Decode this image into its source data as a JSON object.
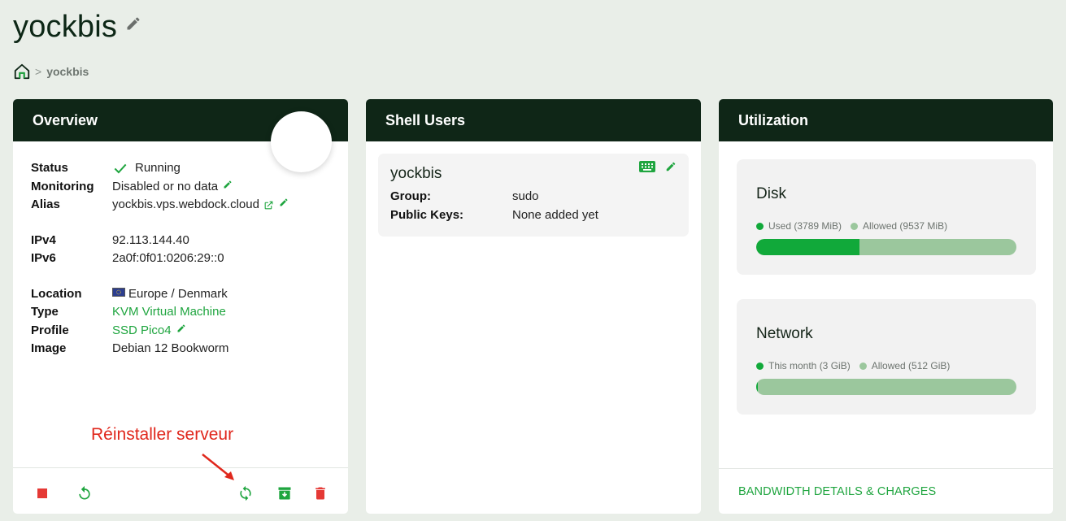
{
  "page": {
    "title": "yockbis",
    "breadcrumb": {
      "current": "yockbis",
      "separator": ">"
    }
  },
  "overview": {
    "header": "Overview",
    "rows": {
      "status": {
        "label": "Status",
        "value": "Running"
      },
      "monitoring": {
        "label": "Monitoring",
        "value": "Disabled or no data"
      },
      "alias": {
        "label": "Alias",
        "value": "yockbis.vps.webdock.cloud"
      },
      "ipv4": {
        "label": "IPv4",
        "value": "92.113.144.40"
      },
      "ipv6": {
        "label": "IPv6",
        "value": "2a0f:0f01:0206:29::0"
      },
      "location": {
        "label": "Location",
        "value": "Europe / Denmark"
      },
      "type": {
        "label": "Type",
        "value": "KVM Virtual Machine"
      },
      "profile": {
        "label": "Profile",
        "value": "SSD Pico4"
      },
      "image": {
        "label": "Image",
        "value": "Debian 12 Bookworm"
      }
    },
    "annotation": "Réinstaller serveur",
    "footer_buttons": [
      "stop-icon",
      "restart-icon",
      "reinstall-icon",
      "archive-icon",
      "trash-icon"
    ]
  },
  "shell": {
    "header": "Shell Users",
    "users": [
      {
        "name": "yockbis",
        "group_label": "Group:",
        "group": "sudo",
        "keys_label": "Public Keys:",
        "keys": "None added yet"
      }
    ]
  },
  "utilization": {
    "header": "Utilization",
    "disk": {
      "title": "Disk",
      "used_label": "Used (3789 MiB)",
      "allowed_label": "Allowed (9537 MiB)",
      "used_fraction": 0.397
    },
    "network": {
      "title": "Network",
      "used_label": "This month (3 GiB)",
      "allowed_label": "Allowed (512 GiB)",
      "used_fraction": 0.006
    },
    "footer_link": "BANDWIDTH DETAILS & CHARGES"
  },
  "colors": {
    "header_bg": "#0f2617",
    "accent_green": "#1fa53f",
    "bar_fill": "#11a93a",
    "bar_track": "#9bc79d",
    "danger": "#e53935",
    "annotation": "#e0271c"
  }
}
